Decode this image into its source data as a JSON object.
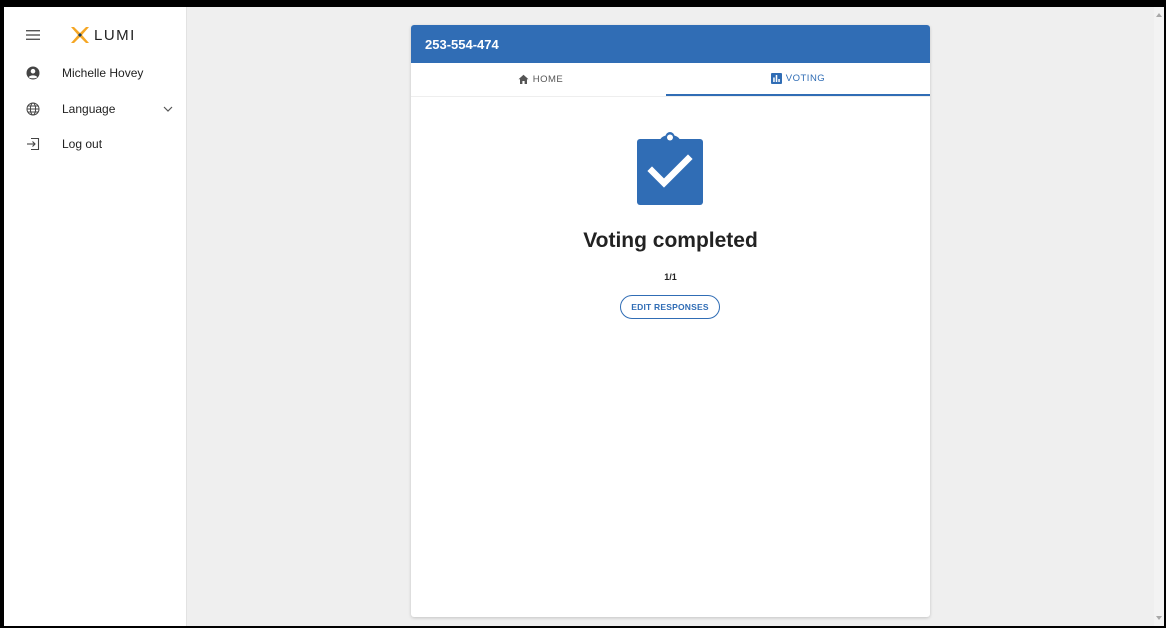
{
  "sidebar": {
    "logo_text": "LUMI",
    "user_name": "Michelle Hovey",
    "language_label": "Language",
    "logout_label": "Log out"
  },
  "meeting": {
    "id": "253-554-474"
  },
  "tabs": [
    {
      "label": "HOME",
      "icon": "home-icon",
      "active": false
    },
    {
      "label": "VOTING",
      "icon": "bar-chart-icon",
      "active": true
    }
  ],
  "voting": {
    "status_title": "Voting completed",
    "progress": "1/1",
    "edit_button_label": "EDIT RESPONSES"
  },
  "colors": {
    "primary": "#306db5",
    "logo_orange": "#f5a623",
    "logo_dark": "#1a3c5a"
  }
}
